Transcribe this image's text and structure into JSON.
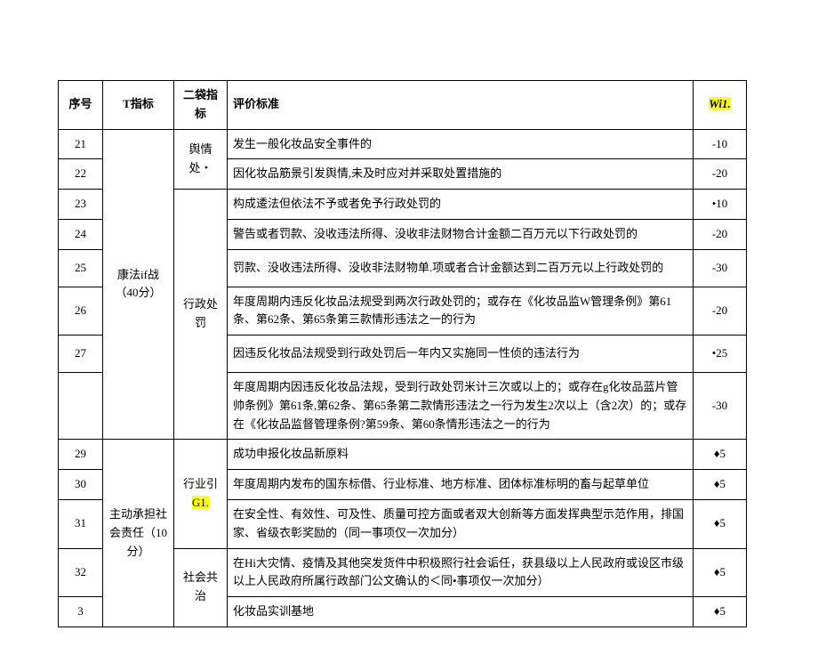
{
  "header": {
    "seq": "序号",
    "t": "T指标",
    "sub": "二袋指标",
    "std": "评价标准",
    "wi": "Wi1."
  },
  "groups": {
    "g1": {
      "label": "康法if战（40分）"
    },
    "g2": {
      "label": "主动承担社会责任（10分）"
    }
  },
  "subs": {
    "s1": "舆情处・",
    "s2": "行政处罚",
    "s3": "行业引G1.",
    "s4": "社会共治"
  },
  "rows": {
    "r21": {
      "seq": "21",
      "std": "发生一般化妆品安全事件的",
      "wi": "-10"
    },
    "r22": {
      "seq": "22",
      "std": "因化妆品筋景引发舆情,未及时应对并采取处置措施的",
      "wi": "-20"
    },
    "r23": {
      "seq": "23",
      "std": "构成逶法但依法不予或者免予行政处罚的",
      "wi": "•10"
    },
    "r24": {
      "seq": "24",
      "std": "警告或者罚款、没收违法所得、没收非法财物合计金额二百万元以下行政处罚的",
      "wi": "-20"
    },
    "r25": {
      "seq": "25",
      "std": "罚款、没收违法所得、没收非法财物单.项或者合计金额达到二百万元以上行政处罚的",
      "wi": "-30"
    },
    "r26": {
      "seq": "26",
      "std": "年度周期内违反化妆品法规受到两次行政处罚的；或存在《化妆品监W管理条例》第61条、第62条、第65条第三款情形违法之一的行为",
      "wi": "-20"
    },
    "r27": {
      "seq": "27",
      "std": "因违反化妆品法规受到行政处罚后一年内又实施同一性侦的违法行为",
      "wi": "•25"
    },
    "r28": {
      "seq": "",
      "std": "年度周期内因违反化妆品法规，受到行政处罚米计三次或以上的；或存在g化妆品蓝片管帅条例》第61条,第62条、第65条第二款情形违法之一行为发生2次以上（含2次）的；或存在《化妆品监督管理条例?第59条、第60条情形违法之一的行为",
      "wi": "-30"
    },
    "r29": {
      "seq": "29",
      "std": "成功申报化妆品新原料",
      "wi": "♦5"
    },
    "r30": {
      "seq": "30",
      "std": "年度周期内发布的国东标借、行业标准、地方标准、团体标准标明的畜与起草单位",
      "wi": "♦5"
    },
    "r31": {
      "seq": "31",
      "std": "在安全性、有效性、可及性、质量可控方面或者双大创新等方面发挥典型示范作用，排国家、省级衣彰奖励的（同一事项仅一次加分）",
      "wi": "♦5"
    },
    "r32": {
      "seq": "32",
      "std": "在Hi大灾情、疫情及其他突发货件中积极照行社会诟任，获县级以上人民政府或设区市级以上人民政府所属行政部门公文确认的＜同•事项仅一次加分）",
      "wi": "♦5"
    },
    "r33": {
      "seq": "3",
      "std": "化妆品实训基地",
      "wi": "♦5"
    }
  }
}
